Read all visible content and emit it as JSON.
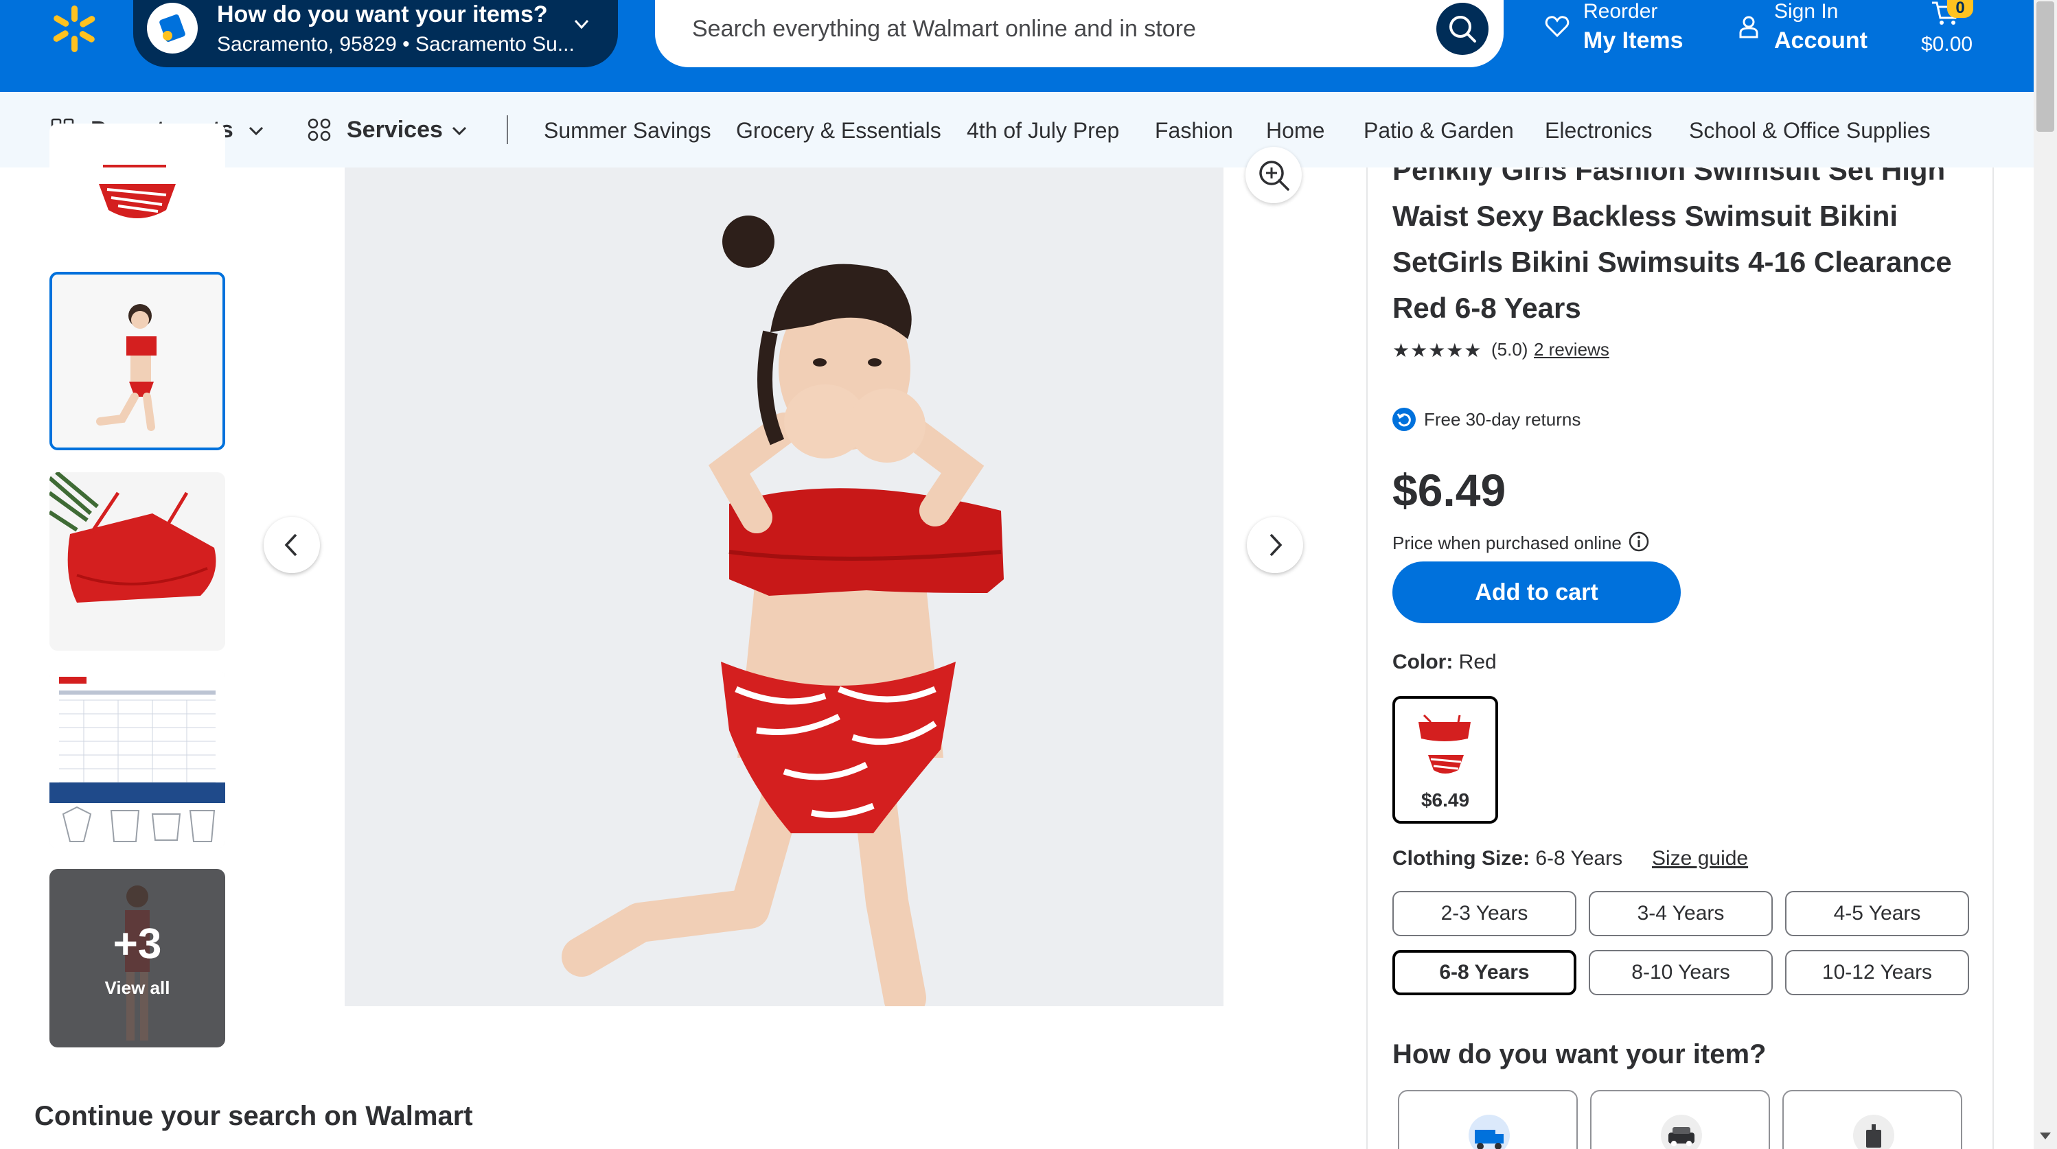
{
  "header": {
    "location_title": "How do you want your items?",
    "location_sub": "Sacramento, 95829 • Sacramento Su...",
    "search_placeholder": "Search everything at Walmart online and in store",
    "reorder_l1": "Reorder",
    "reorder_l2": "My Items",
    "signin_l1": "Sign In",
    "signin_l2": "Account",
    "cart_count": "0",
    "cart_total": "$0.00"
  },
  "nav": {
    "departments": "Departments",
    "services": "Services",
    "items": [
      "Summer Savings",
      "Grocery & Essentials",
      "4th of July Prep",
      "Fashion",
      "Home",
      "Patio & Garden",
      "Electronics",
      "School & Office Supplies"
    ]
  },
  "gallery": {
    "view_all_count": "+3",
    "view_all_label": "View all"
  },
  "continue_title": "Continue your search on Walmart",
  "product": {
    "title": "Penkiiy Girls Fashion Swimsuit Set High Waist Sexy Backless Swimsuit Bikini SetGirls Bikini Swimsuits 4-16 Clearance Red 6-8 Years",
    "stars": "★★★★★",
    "rating": "(5.0)",
    "reviews": "2 reviews",
    "returns": "Free 30-day returns",
    "price": "$6.49",
    "price_note": "Price when purchased online",
    "add_to_cart": "Add to cart",
    "color_label": "Color:",
    "color_value": "Red",
    "swatch_price": "$6.49",
    "size_label": "Clothing Size:",
    "size_value": "6-8 Years",
    "size_guide": "Size guide",
    "sizes": [
      "2-3 Years",
      "3-4 Years",
      "4-5 Years",
      "6-8 Years",
      "8-10 Years",
      "10-12 Years"
    ],
    "selected_size": "6-8 Years",
    "how_title": "How do you want your item?"
  },
  "colors": {
    "brand_blue": "#0071dc",
    "dark_blue": "#002d58",
    "yellow": "#ffc220",
    "swimsuit_red": "#d41f1f"
  }
}
